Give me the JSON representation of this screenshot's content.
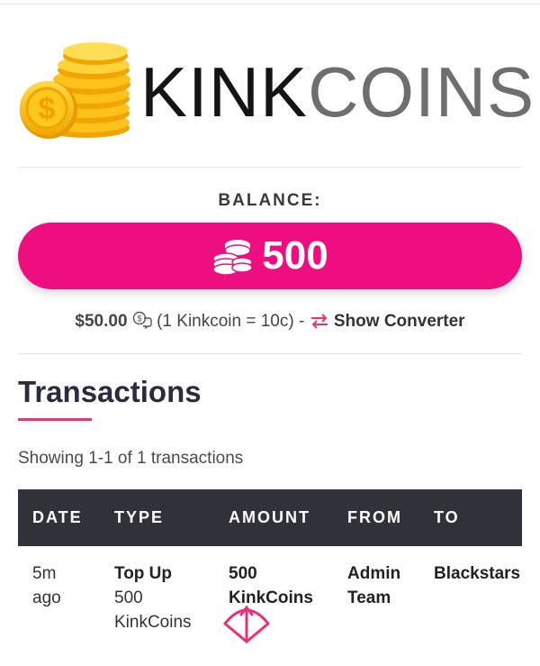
{
  "brand": {
    "name_part1": "KINK",
    "name_part2": "COINS"
  },
  "balance": {
    "label": "BALANCE:",
    "value": "500",
    "icon": "coin-stack-icon"
  },
  "conversion": {
    "usd_value": "$50.00",
    "rate_text": "(1 Kinkcoin = 10c) -",
    "converter_label": "Show Converter",
    "icons": [
      "money-chat-icon",
      "swap-arrows-icon"
    ]
  },
  "transactions": {
    "title": "Transactions",
    "showing_text": "Showing 1-1 of 1 transactions",
    "columns": [
      "DATE",
      "TYPE",
      "AMOUNT",
      "FROM",
      "TO"
    ],
    "rows": [
      {
        "date": [
          "5m",
          "ago"
        ],
        "type_bold": "Top Up",
        "type_detail": [
          "500",
          "KinkCoins"
        ],
        "amount": [
          "500",
          "KinkCoins"
        ],
        "from": [
          "Admin",
          "Team"
        ],
        "to": "Blackstars"
      }
    ]
  },
  "colors": {
    "accent": "#ee0e7f",
    "header_dark": "#2f3238",
    "underline": "#e4366f",
    "coin_gold": "#f5b800"
  },
  "floating_icon": "bow-arrow-icon"
}
